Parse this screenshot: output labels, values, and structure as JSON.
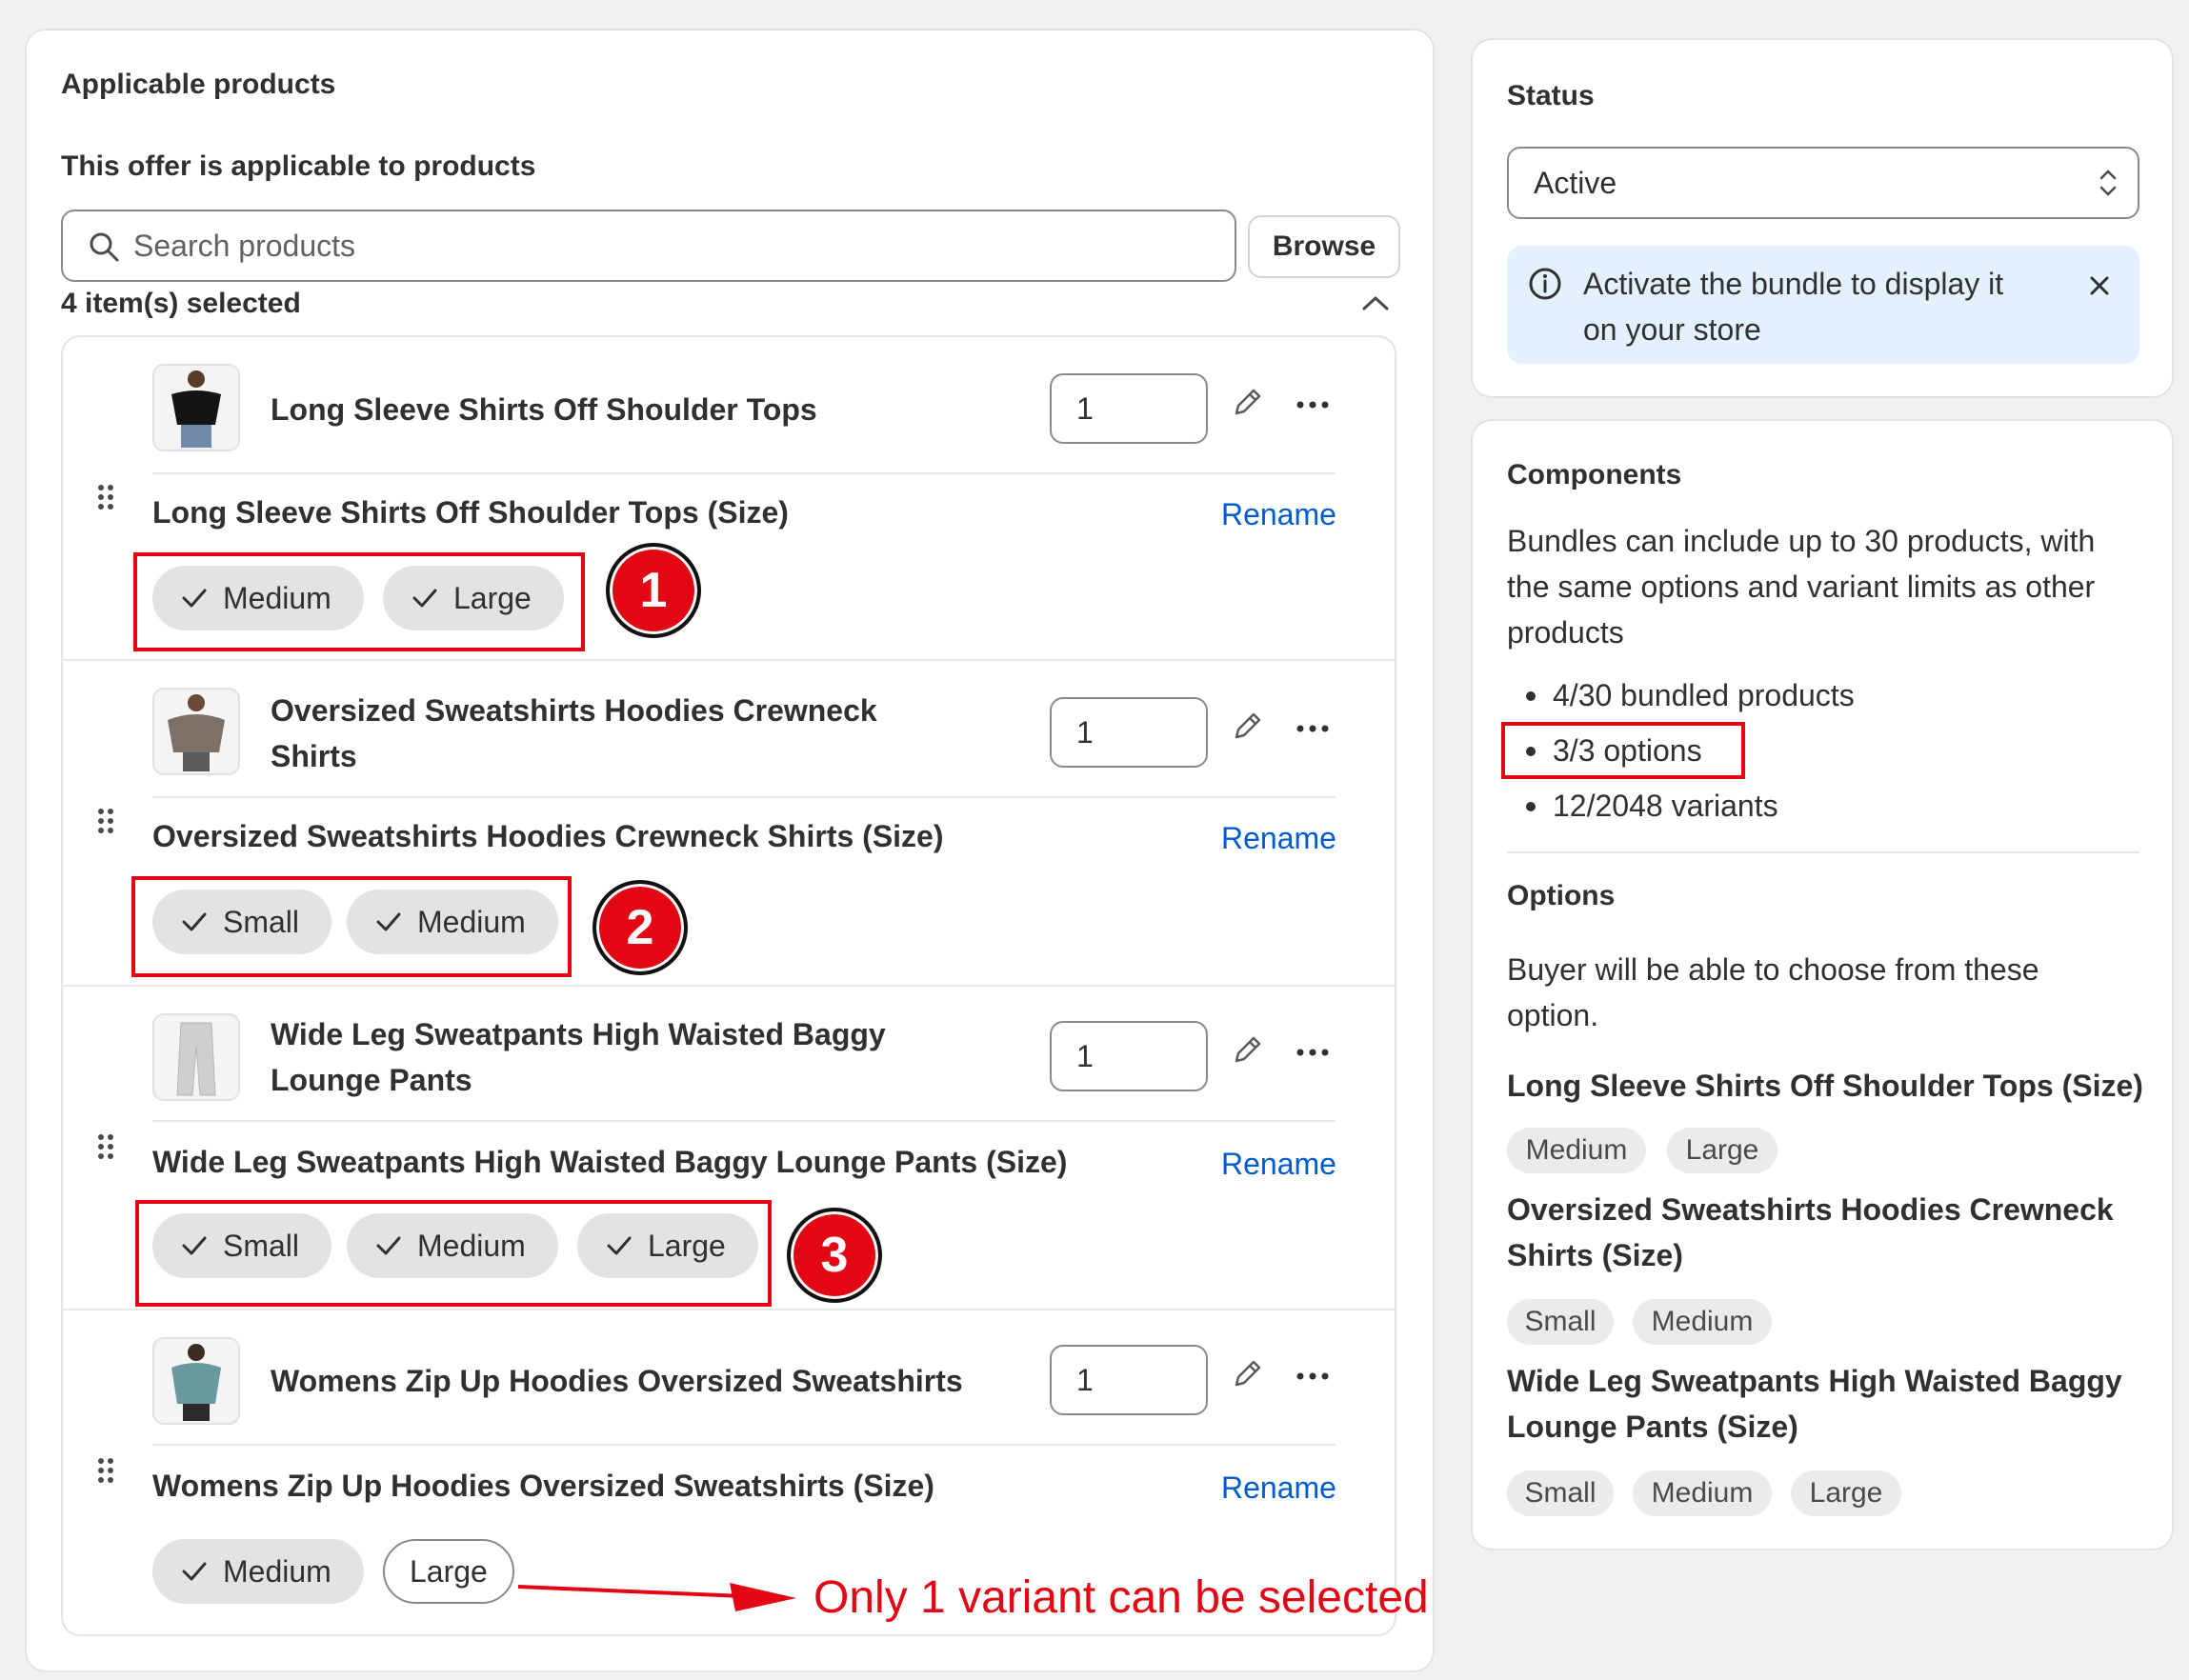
{
  "left_card": {
    "title": "Applicable products",
    "subtitle": "This offer is applicable to products",
    "search_placeholder": "Search products",
    "browse_label": "Browse",
    "selected_count": "4 item(s) selected",
    "rename_label": "Rename",
    "products": [
      {
        "name_line1": "Long Sleeve Shirts Off Shoulder Tops",
        "name_line2": "",
        "quantity": "1",
        "option_title": "Long Sleeve Shirts Off Shoulder Tops (Size)",
        "variants": [
          {
            "label": "Medium",
            "selected": true
          },
          {
            "label": "Large",
            "selected": true
          }
        ]
      },
      {
        "name_line1": "Oversized Sweatshirts Hoodies Crewneck",
        "name_line2": "Shirts",
        "quantity": "1",
        "option_title": "Oversized Sweatshirts Hoodies Crewneck Shirts (Size)",
        "variants": [
          {
            "label": "Small",
            "selected": true
          },
          {
            "label": "Medium",
            "selected": true
          }
        ]
      },
      {
        "name_line1": "Wide Leg Sweatpants High Waisted Baggy",
        "name_line2": "Lounge Pants",
        "quantity": "1",
        "option_title": "Wide Leg Sweatpants High Waisted Baggy Lounge Pants (Size)",
        "variants": [
          {
            "label": "Small",
            "selected": true
          },
          {
            "label": "Medium",
            "selected": true
          },
          {
            "label": "Large",
            "selected": true
          }
        ]
      },
      {
        "name_line1": "Womens Zip Up Hoodies Oversized Sweatshirts",
        "name_line2": "",
        "quantity": "1",
        "option_title": "Womens Zip Up Hoodies Oversized Sweatshirts (Size)",
        "variants": [
          {
            "label": "Medium",
            "selected": true
          },
          {
            "label": "Large",
            "selected": false
          }
        ]
      }
    ]
  },
  "annotations": {
    "badges": [
      "1",
      "2",
      "3"
    ],
    "note": "Only 1 variant can be selected",
    "accent_color": "#e30613"
  },
  "status_card": {
    "title": "Status",
    "selected_value": "Active",
    "banner_line1": "Activate the bundle to display it",
    "banner_line2": "on your store",
    "banner_bg": "#e2f1fd"
  },
  "components_card": {
    "title": "Components",
    "desc_line1": "Bundles can include up to 30 products, with",
    "desc_line2": "the same options and variant limits as other",
    "desc_line3": "products",
    "stats": [
      "4/30 bundled products",
      "3/3 options",
      "12/2048 variants"
    ],
    "options_title": "Options",
    "options_desc_line1": "Buyer will be able to choose from these",
    "options_desc_line2": "option.",
    "option_groups": [
      {
        "title_line1": "Long Sleeve Shirts Off Shoulder Tops (Size)",
        "title_line2": "",
        "values": [
          "Medium",
          "Large"
        ]
      },
      {
        "title_line1": "Oversized Sweatshirts Hoodies Crewneck",
        "title_line2": "Shirts (Size)",
        "values": [
          "Small",
          "Medium"
        ]
      },
      {
        "title_line1": "Wide Leg Sweatpants High Waisted Baggy",
        "title_line2": "Lounge Pants (Size)",
        "values": [
          "Small",
          "Medium",
          "Large"
        ]
      }
    ]
  }
}
